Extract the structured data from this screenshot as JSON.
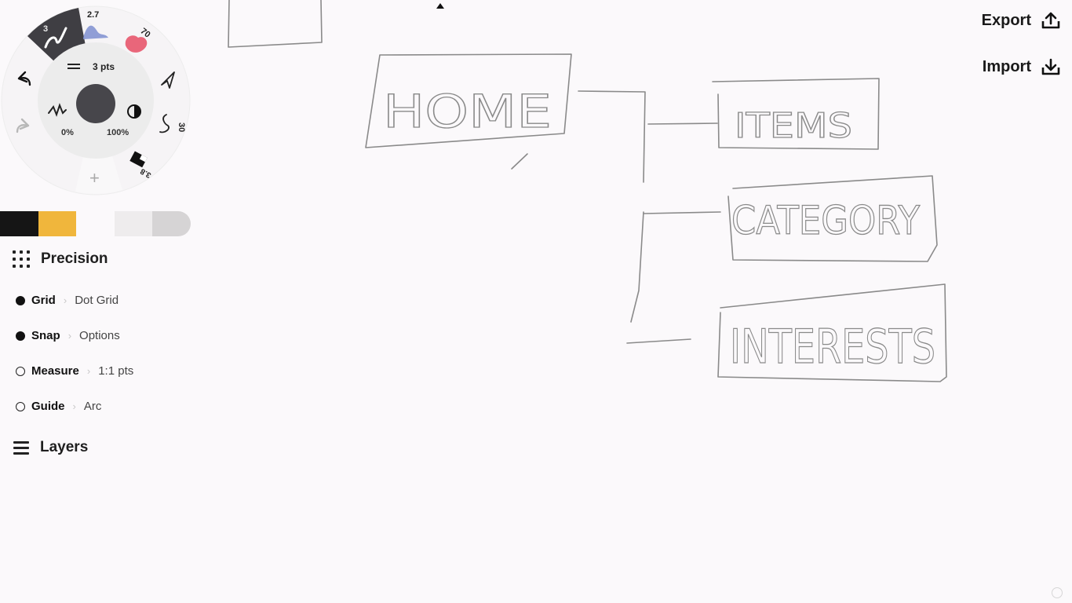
{
  "tool_wheel": {
    "tool_sizes": [
      "3",
      "2.7",
      "70",
      "30",
      "3.8"
    ],
    "stroke_label": "3 pts",
    "smoothing_value": "0%",
    "opacity_value": "100%",
    "add_label": "+"
  },
  "colors": {
    "swatches": [
      "#151515",
      "#f0b63c",
      "#fbf9fb",
      "#eeeced",
      "#d6d4d5"
    ],
    "ink": "#8a8a8a",
    "background": "#fbf9fb"
  },
  "precision": {
    "title": "Precision",
    "options": [
      {
        "label": "Grid",
        "value": "Dot Grid",
        "enabled": true
      },
      {
        "label": "Snap",
        "value": "Options",
        "enabled": true
      },
      {
        "label": "Measure",
        "value": "1:1 pts",
        "enabled": false
      },
      {
        "label": "Guide",
        "value": "Arc",
        "enabled": false
      }
    ]
  },
  "layers": {
    "title": "Layers"
  },
  "actions": {
    "export_label": "Export",
    "import_label": "Import"
  },
  "sketch": {
    "home_label": "HOME",
    "items_label": "ITEMS",
    "category_label": "CATEGORY",
    "interests_label": "INTERESTS"
  }
}
